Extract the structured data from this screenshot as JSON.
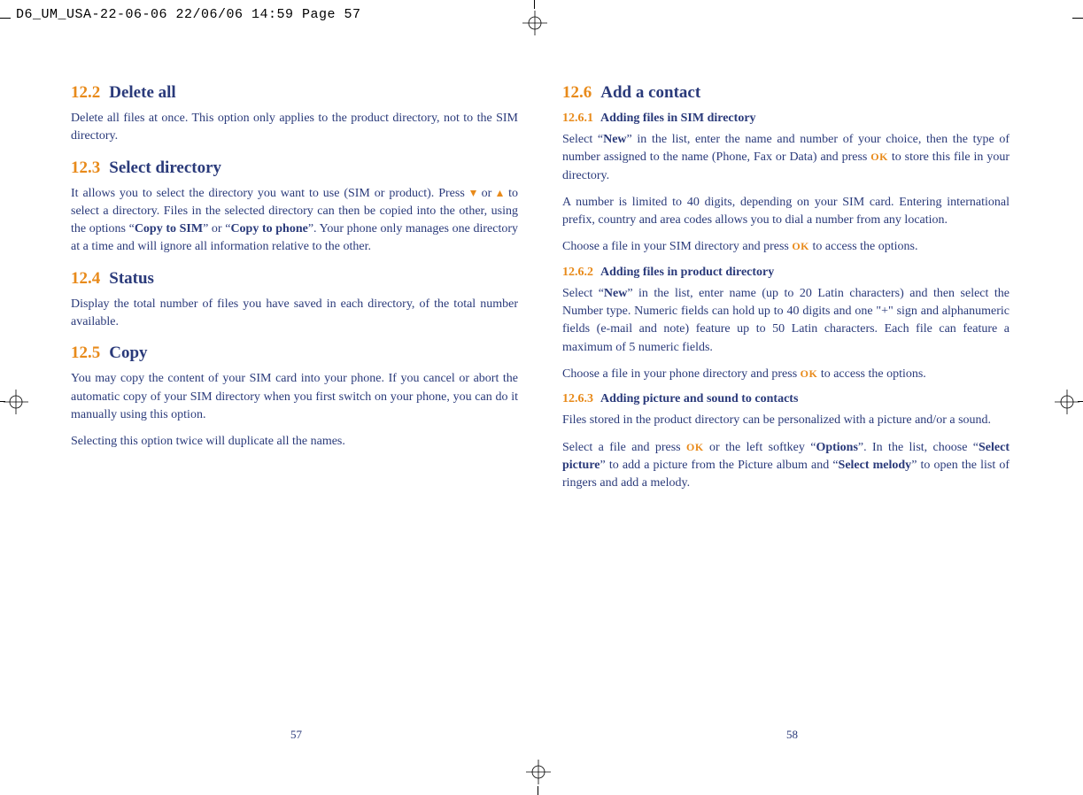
{
  "print_header": "D6_UM_USA-22-06-06  22/06/06  14:59  Page 57",
  "page_left_num": "57",
  "page_right_num": "58",
  "left": {
    "s122": {
      "num": "12.2",
      "title": "Delete all",
      "p1": "Delete all files at once. This option only applies to the product directory, not to the SIM directory."
    },
    "s123": {
      "num": "12.3",
      "title": "Select directory",
      "p1a": "It allows you to select the directory you want to use (SIM or product). Press ",
      "p1b": " or ",
      "p1c": " to select a directory. Files in the selected directory can then be copied into the other, using the options “",
      "copy_sim": "Copy to SIM",
      "p1d": "” or “",
      "copy_phone": "Copy to phone",
      "p1e": "”. Your phone only manages one directory at a time and will ignore all information relative to the other."
    },
    "s124": {
      "num": "12.4",
      "title": "Status",
      "p1": "Display the total number of files you have saved in each directory, of the total number available."
    },
    "s125": {
      "num": "12.5",
      "title": "Copy",
      "p1": "You may copy the content of your SIM card into your phone. If you cancel or abort the automatic copy of your SIM directory when you first switch on your phone, you can do it manually using this option.",
      "p2": "Selecting this option twice will duplicate all the names."
    }
  },
  "right": {
    "s126": {
      "num": "12.6",
      "title": "Add a contact"
    },
    "s1261": {
      "num": "12.6.1",
      "title": "Adding files in SIM directory",
      "p1a": "Select “",
      "new": "New",
      "p1b": "” in the list, enter the name and number of your choice, then the type of number assigned to the name (Phone, Fax or Data) and press ",
      "p1c": " to store this file in your directory.",
      "p2": "A number is limited to 40 digits, depending on your SIM card. Entering international prefix, country and area codes allows you to dial a number from any location.",
      "p3a": "Choose a file in your SIM directory and press ",
      "p3b": " to access the options."
    },
    "s1262": {
      "num": "12.6.2",
      "title": "Adding files in product directory",
      "p1a": "Select “",
      "new": "New",
      "p1b": "” in the list, enter name (up to 20 Latin characters) and then select the Number type. Numeric fields can hold up to 40 digits and one \"+\" sign and alphanumeric fields (e-mail and note) feature up to 50 Latin characters. Each file can feature a maximum of 5 numeric fields.",
      "p2a": "Choose a file in your phone directory and press ",
      "p2b": " to access the options."
    },
    "s1263": {
      "num": "12.6.3",
      "title": "Adding picture and sound to contacts",
      "p1": "Files stored in the product directory can be personalized with a picture and/or a sound.",
      "p2a": "Select a file and press ",
      "p2b": " or the left softkey “",
      "options": "Options",
      "p2c": "”. In the list, choose “",
      "select_picture": "Select picture",
      "p2d": "” to add a picture from the Picture album and “",
      "select_melody": "Select melody",
      "p2e": "” to open the list of ringers and add a melody."
    }
  },
  "ok_label": "OK"
}
